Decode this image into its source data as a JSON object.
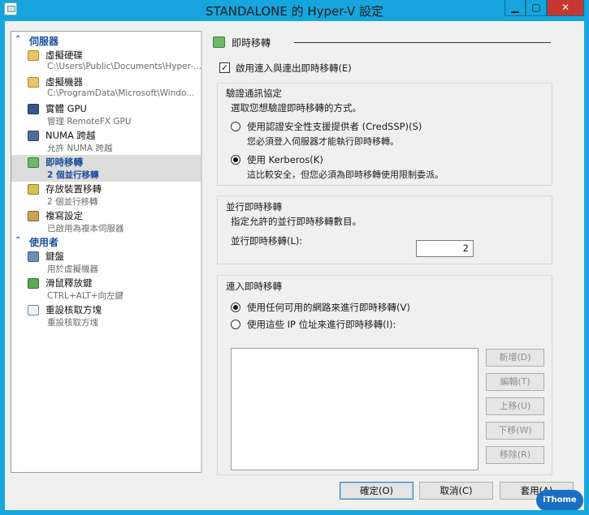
{
  "window": {
    "title": "STANDALONE 的 Hyper-V 設定",
    "controls": {
      "minimize": "▁",
      "maximize": "▢",
      "close": "✕"
    }
  },
  "sidebar": {
    "sections": [
      {
        "label": "伺服器",
        "icon": "chevron-up-icon"
      },
      {
        "label": "使用者",
        "icon": "chevron-up-icon"
      }
    ],
    "items": [
      {
        "label": "虛擬硬碟",
        "sub": "C:\\Users\\Public\\Documents\\Hyper-...",
        "icon": "folder-icon"
      },
      {
        "label": "虛擬機器",
        "sub": "C:\\ProgramData\\Microsoft\\Windo...",
        "icon": "folder-icon"
      },
      {
        "label": "實體 GPU",
        "sub": "管理 RemoteFX GPU",
        "icon": "monitor-icon"
      },
      {
        "label": "NUMA 跨越",
        "sub": "允許 NUMA 跨越",
        "icon": "numa-icon"
      },
      {
        "label": "即時移轉",
        "sub": "2 個並行移轉",
        "icon": "live-migration-icon"
      },
      {
        "label": "存放裝置移轉",
        "sub": "2 個並行移轉",
        "icon": "storage-migration-icon"
      },
      {
        "label": "複寫設定",
        "sub": "已啟用為複本伺服器",
        "icon": "replication-icon"
      },
      {
        "label": "鍵盤",
        "sub": "用於虛擬機器",
        "icon": "keyboard-icon"
      },
      {
        "label": "滑鼠釋放鍵",
        "sub": "CTRL+ALT+向左鍵",
        "icon": "mouse-icon"
      },
      {
        "label": "重設核取方塊",
        "sub": "重設核取方塊",
        "icon": "checkbox-reset-icon"
      }
    ]
  },
  "main": {
    "page_title": "即時移轉",
    "enable_checkbox": {
      "label": "啟用連入與連出即時移轉(E)",
      "checked": true
    },
    "auth_group": {
      "title": "驗證通訊協定",
      "description": "選取您想驗證即時移轉的方式。",
      "options": [
        {
          "label": "使用認證安全性支援提供者 (CredSSP)(S)",
          "sub": "您必須登入伺服器才能執行即時移轉。",
          "selected": false
        },
        {
          "label": "使用 Kerberos(K)",
          "sub": "這比較安全，但您必須為即時移轉使用限制委派。",
          "selected": true
        }
      ]
    },
    "concurrent_group": {
      "title": "並行即時移轉",
      "description": "指定允許的並行即時移轉數目。",
      "field_label": "並行即時移轉(L):",
      "field_value": "2"
    },
    "incoming_group": {
      "title": "連入即時移轉",
      "options": [
        {
          "label": "使用任何可用的網路來進行即時移轉(V)",
          "selected": true
        },
        {
          "label": "使用這些 IP 位址來進行即時移轉(I):",
          "selected": false
        }
      ],
      "buttons": [
        "新增(D)",
        "編輯(T)",
        "上移(U)",
        "下移(W)",
        "移除(R)"
      ]
    }
  },
  "footer": {
    "ok": "確定(O)",
    "cancel": "取消(C)",
    "apply": "套用(A)"
  },
  "watermark": "iThome"
}
